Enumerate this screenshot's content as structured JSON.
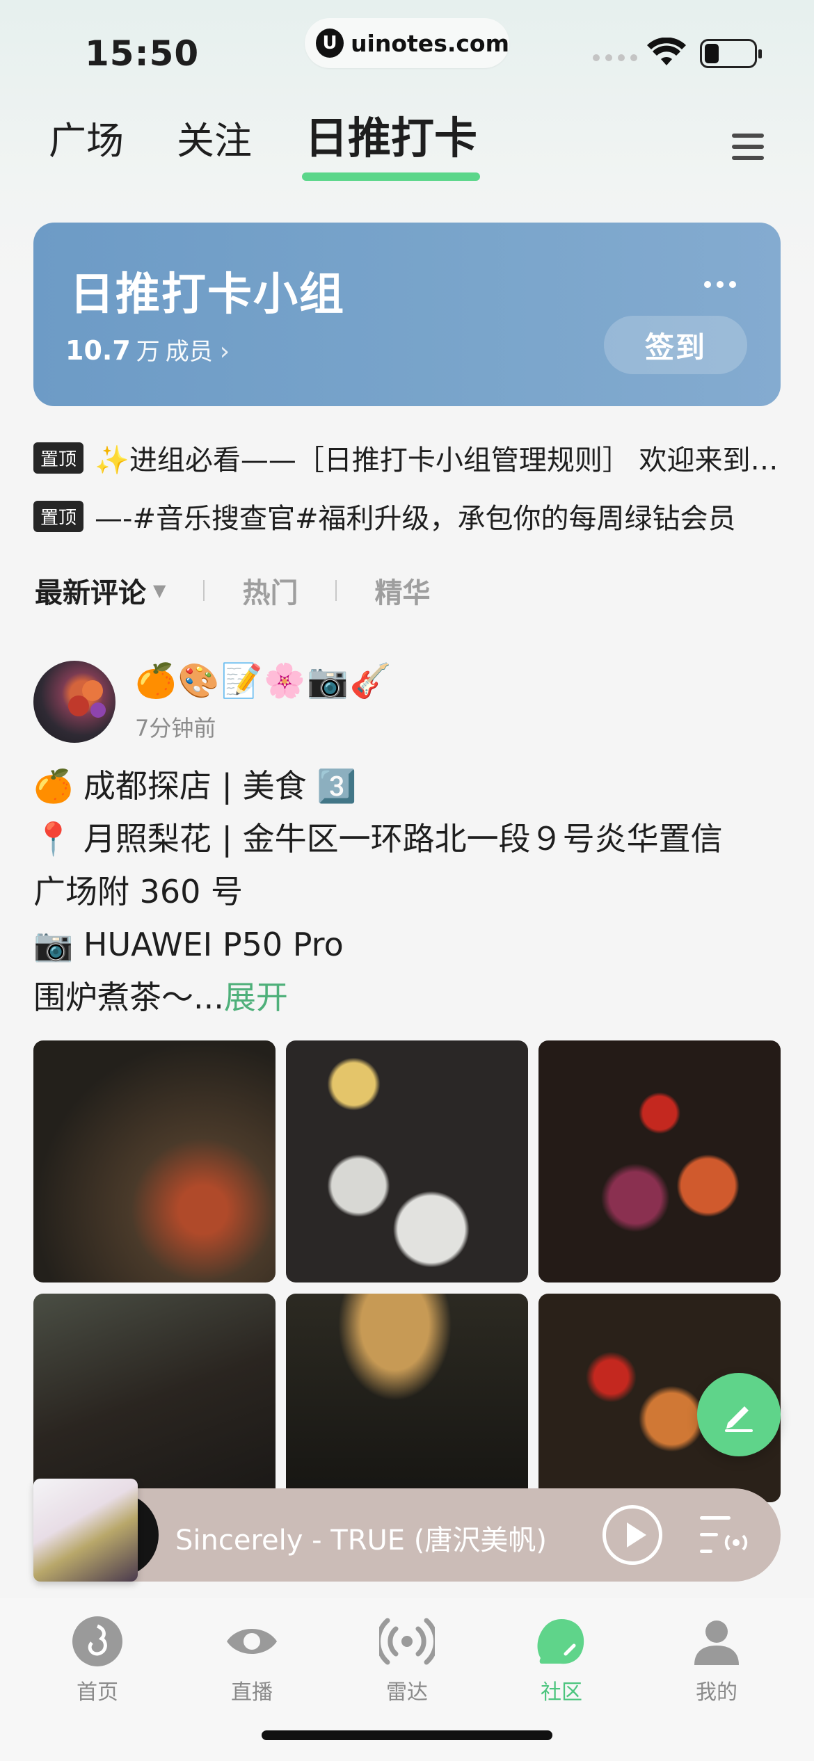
{
  "status_bar": {
    "time": "15:50",
    "url": "uinotes.com"
  },
  "top_tabs": [
    {
      "label": "广场",
      "active": false
    },
    {
      "label": "关注",
      "active": false
    },
    {
      "label": "日推打卡",
      "active": true
    }
  ],
  "group": {
    "name": "日推打卡小组",
    "members_count": "10.7",
    "members_unit": "万",
    "members_label": "成员",
    "checkin_label": "签到",
    "card_color": "#7aa5cb"
  },
  "pinned": [
    {
      "badge": "置顶",
      "text": "✨进组必看——［日推打卡小组管理规则］ 欢迎来到日推打卡小组"
    },
    {
      "badge": "置顶",
      "text": "—-#音乐搜查官#福利升级，承包你的每周绿钻会员"
    }
  ],
  "sort_tabs": {
    "active": "最新评论",
    "hot": "热门",
    "featured": "精华"
  },
  "post": {
    "author_emojis": "🍊🎨📝🌸📷🎸",
    "time": "7分钟前",
    "lines": [
      "🍊 成都探店 | 美食 3️⃣",
      "📍 月照梨花 | 金牛区一环路北一段９号炎华置信",
      "广场附 360 号",
      "📷 HUAWEI P50 Pro"
    ],
    "last_line": "围炉煮茶～...",
    "expand_label": "展开"
  },
  "player": {
    "song": "Sincerely - TRUE (唐沢美帆)"
  },
  "bottom_nav": [
    {
      "label": "首页",
      "icon": "music-note-icon",
      "active": false
    },
    {
      "label": "直播",
      "icon": "eye-icon",
      "active": false
    },
    {
      "label": "雷达",
      "icon": "radar-icon",
      "active": false
    },
    {
      "label": "社区",
      "icon": "community-icon",
      "active": true
    },
    {
      "label": "我的",
      "icon": "profile-icon",
      "active": false
    }
  ],
  "colors": {
    "accent_green": "#5bd68a",
    "active_nav": "#4cc57e"
  }
}
